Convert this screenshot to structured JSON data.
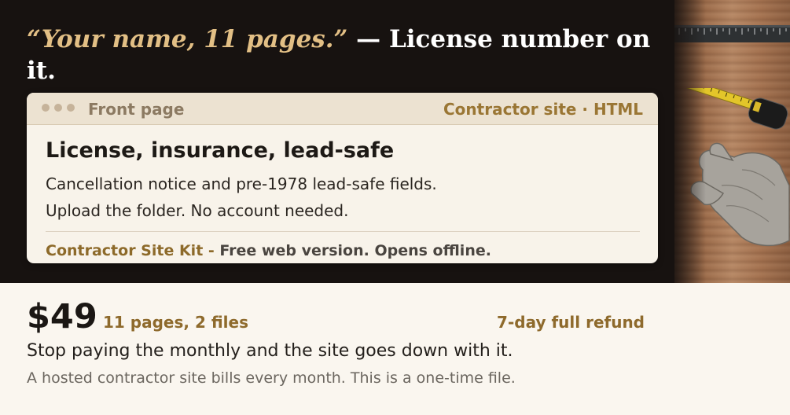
{
  "hero": {
    "headline_quote": "“Your name, 11 pages.”",
    "headline_rest": "— License number on it."
  },
  "card": {
    "tab_label": "Front page",
    "tab_meta": "Contractor site · HTML",
    "title": "License, insurance, lead-safe",
    "line1": "Cancellation notice and pre-1978 lead-safe fields.",
    "line2": "Upload the folder. No account needed.",
    "footer_brand": "Contractor Site Kit -",
    "footer_text": "Free web version. Opens offline."
  },
  "offer": {
    "price": "$49",
    "includes": "11 pages, 2 files",
    "refund": "7-day full refund",
    "pitch": "Stop paying the monthly and the site goes down with it.",
    "fineprint": "A hosted contractor site bills every month. This is a one-time file."
  },
  "photo": {
    "icons": [
      "ruler-icon",
      "tape-measure-icon",
      "work-gloves-icon"
    ]
  },
  "colors": {
    "dark_band": "#171210",
    "accent_gold": "#e2bf85",
    "brand_brown": "#8e6a2c",
    "page_background": "#faf6ef"
  }
}
